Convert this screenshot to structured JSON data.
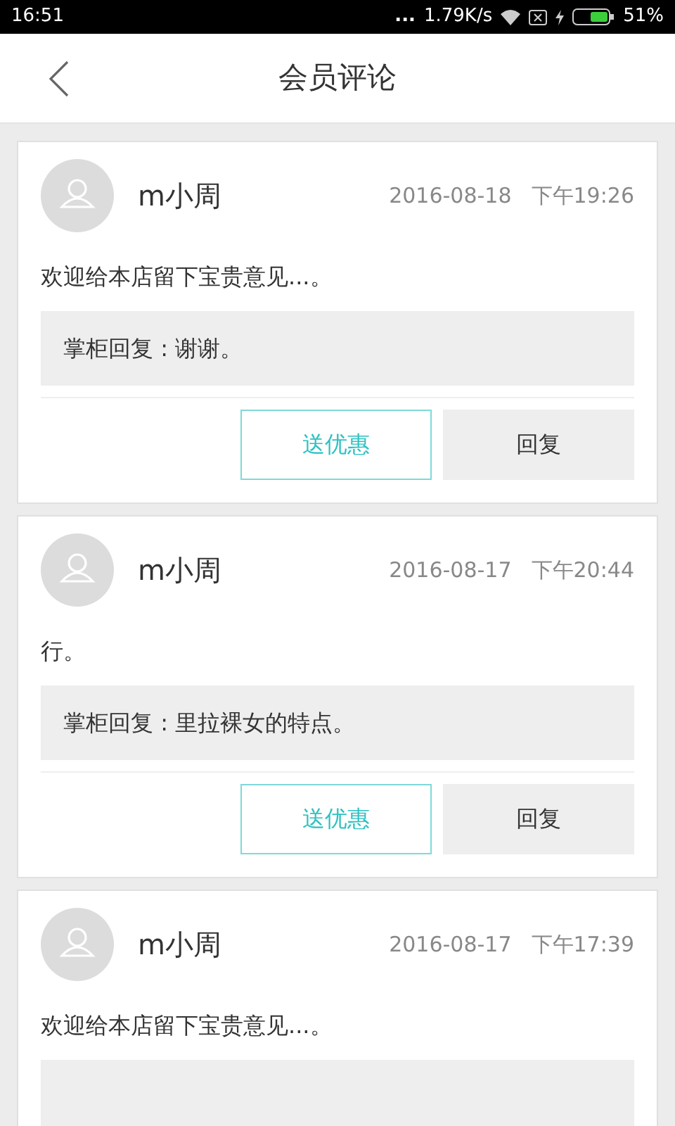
{
  "status_bar": {
    "time": "16:51",
    "dots": "...",
    "speed": "1.79K/s",
    "battery": "51%"
  },
  "header": {
    "title": "会员评论"
  },
  "comments": [
    {
      "name": "m小周",
      "date": "2016-08-18",
      "time": "下午19:26",
      "text": "欢迎给本店留下宝贵意见...。",
      "reply": "掌柜回复 : 谢谢。",
      "buttons": [
        {
          "label": "送优惠",
          "kind": "outline"
        },
        {
          "label": "回复",
          "kind": "filled"
        }
      ]
    },
    {
      "name": "m小周",
      "date": "2016-08-17",
      "time": "下午20:44",
      "text": "行。",
      "reply": "掌柜回复 : 里拉裸女的特点。",
      "buttons": [
        {
          "label": "送优惠",
          "kind": "outline"
        },
        {
          "label": "回复",
          "kind": "filled"
        }
      ]
    },
    {
      "name": "m小周",
      "date": "2016-08-17",
      "time": "下午17:39",
      "text": "欢迎给本店留下宝贵意见...。"
    }
  ]
}
